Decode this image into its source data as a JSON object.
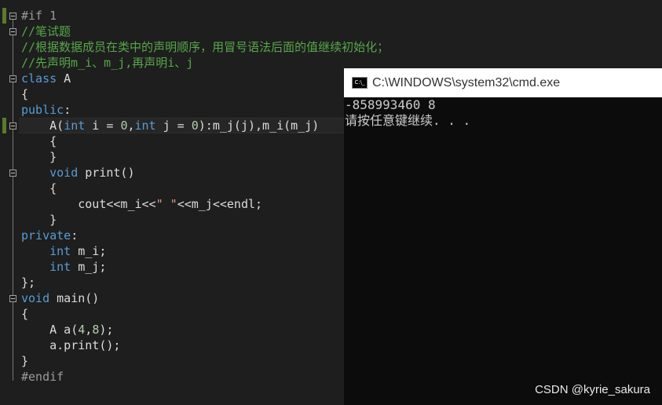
{
  "editor": {
    "lines": [
      [
        [
          "#if 1",
          "pp"
        ]
      ],
      [
        [
          "//笔试题",
          "cm"
        ]
      ],
      [
        [
          "//根据数据成员在类中的声明顺序，用冒号语法后面的值继续初始化；",
          "cm"
        ]
      ],
      [
        [
          "//先声明m_i、m_j,再声明i、j",
          "cm"
        ]
      ],
      [
        [
          "class",
          "kw"
        ],
        [
          " A",
          "tx"
        ]
      ],
      [
        [
          "{",
          "tx"
        ]
      ],
      [
        [
          "public",
          "kw"
        ],
        [
          ":",
          "tx"
        ]
      ],
      [
        [
          "    A(",
          "tx"
        ],
        [
          "int",
          "kw"
        ],
        [
          " i = ",
          "tx"
        ],
        [
          "0",
          "num"
        ],
        [
          ",",
          "tx"
        ],
        [
          "int",
          "kw"
        ],
        [
          " j = ",
          "tx"
        ],
        [
          "0",
          "num"
        ],
        [
          "):m_j(j),m_i(m_j)",
          "tx"
        ]
      ],
      [
        [
          "    {",
          "tx"
        ]
      ],
      [
        [
          "    }",
          "tx"
        ]
      ],
      [
        [
          "    ",
          "tx"
        ],
        [
          "void",
          "kw"
        ],
        [
          " print()",
          "tx"
        ]
      ],
      [
        [
          "    {",
          "tx"
        ]
      ],
      [
        [
          "        cout<<m_i<<",
          "tx"
        ],
        [
          "\" \"",
          "str"
        ],
        [
          "<<m_j<<endl;",
          "tx"
        ]
      ],
      [
        [
          "    }",
          "tx"
        ]
      ],
      [
        [
          "private",
          "kw"
        ],
        [
          ":",
          "tx"
        ]
      ],
      [
        [
          "    ",
          "tx"
        ],
        [
          "int",
          "kw"
        ],
        [
          " m_i;",
          "tx"
        ]
      ],
      [
        [
          "    ",
          "tx"
        ],
        [
          "int",
          "kw"
        ],
        [
          " m_j;",
          "tx"
        ]
      ],
      [
        [
          "};",
          "tx"
        ]
      ],
      [
        [
          "void",
          "kw"
        ],
        [
          " main()",
          "tx"
        ]
      ],
      [
        [
          "{",
          "tx"
        ]
      ],
      [
        [
          "    A a(",
          "tx"
        ],
        [
          "4",
          "num"
        ],
        [
          ",",
          "tx"
        ],
        [
          "8",
          "num"
        ],
        [
          ");",
          "tx"
        ]
      ],
      [
        [
          "    a.print();",
          "tx"
        ]
      ],
      [
        [
          "}",
          "tx"
        ]
      ],
      [
        [
          "#endif",
          "pp"
        ]
      ]
    ]
  },
  "console": {
    "title": "C:\\WINDOWS\\system32\\cmd.exe",
    "icon": "cmd-icon",
    "icon_text": "C:\\_",
    "output": [
      "-858993460 8",
      "请按任意键继续. . ."
    ]
  },
  "watermark": "CSDN @kyrie_sakura"
}
